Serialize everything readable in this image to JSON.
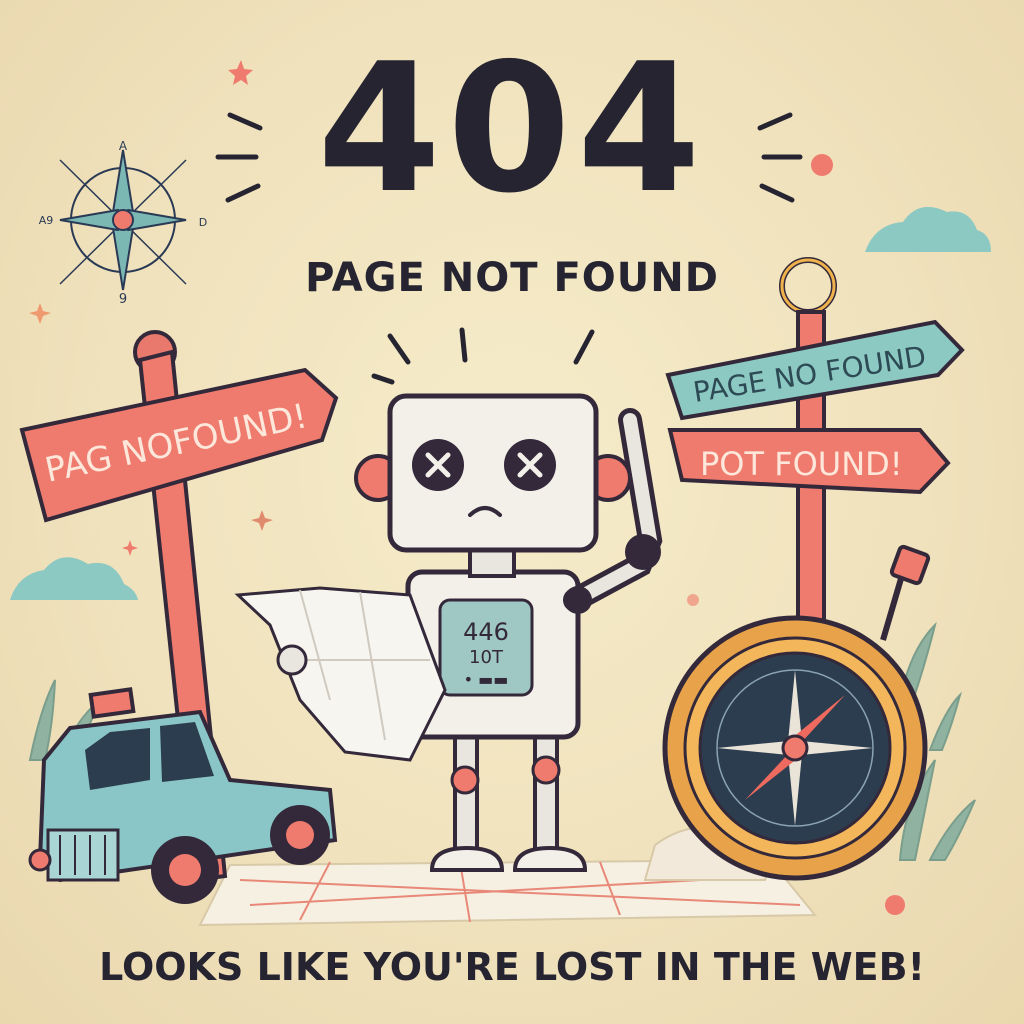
{
  "headline": {
    "code": "404",
    "subtitle": "PAGE NOT FOUND",
    "tagline": "LOOKS LIKE YOU'RE LOST IN THE WEB!"
  },
  "signs": {
    "left": "PAG NOFOUND!",
    "right_top": "PAGE NO FOUND",
    "right_bottom": "POT FOUND!"
  },
  "robot_chest_text": [
    "446",
    "10T",
    "• ▬▬"
  ],
  "compass_rose_labels": {
    "top": "A",
    "left": "A9",
    "right": "D",
    "bottom": "9"
  },
  "colors": {
    "background": "#f1e4c0",
    "ink": "#262431",
    "coral": "#ef7a6e",
    "teal": "#8cc9c2",
    "robot_body": "#f3f0ea"
  },
  "icons": [
    "compass-rose-icon",
    "robot-icon",
    "map-icon",
    "car-icon",
    "compass-icon",
    "signpost-icon",
    "cloud-icon",
    "star-icon"
  ]
}
